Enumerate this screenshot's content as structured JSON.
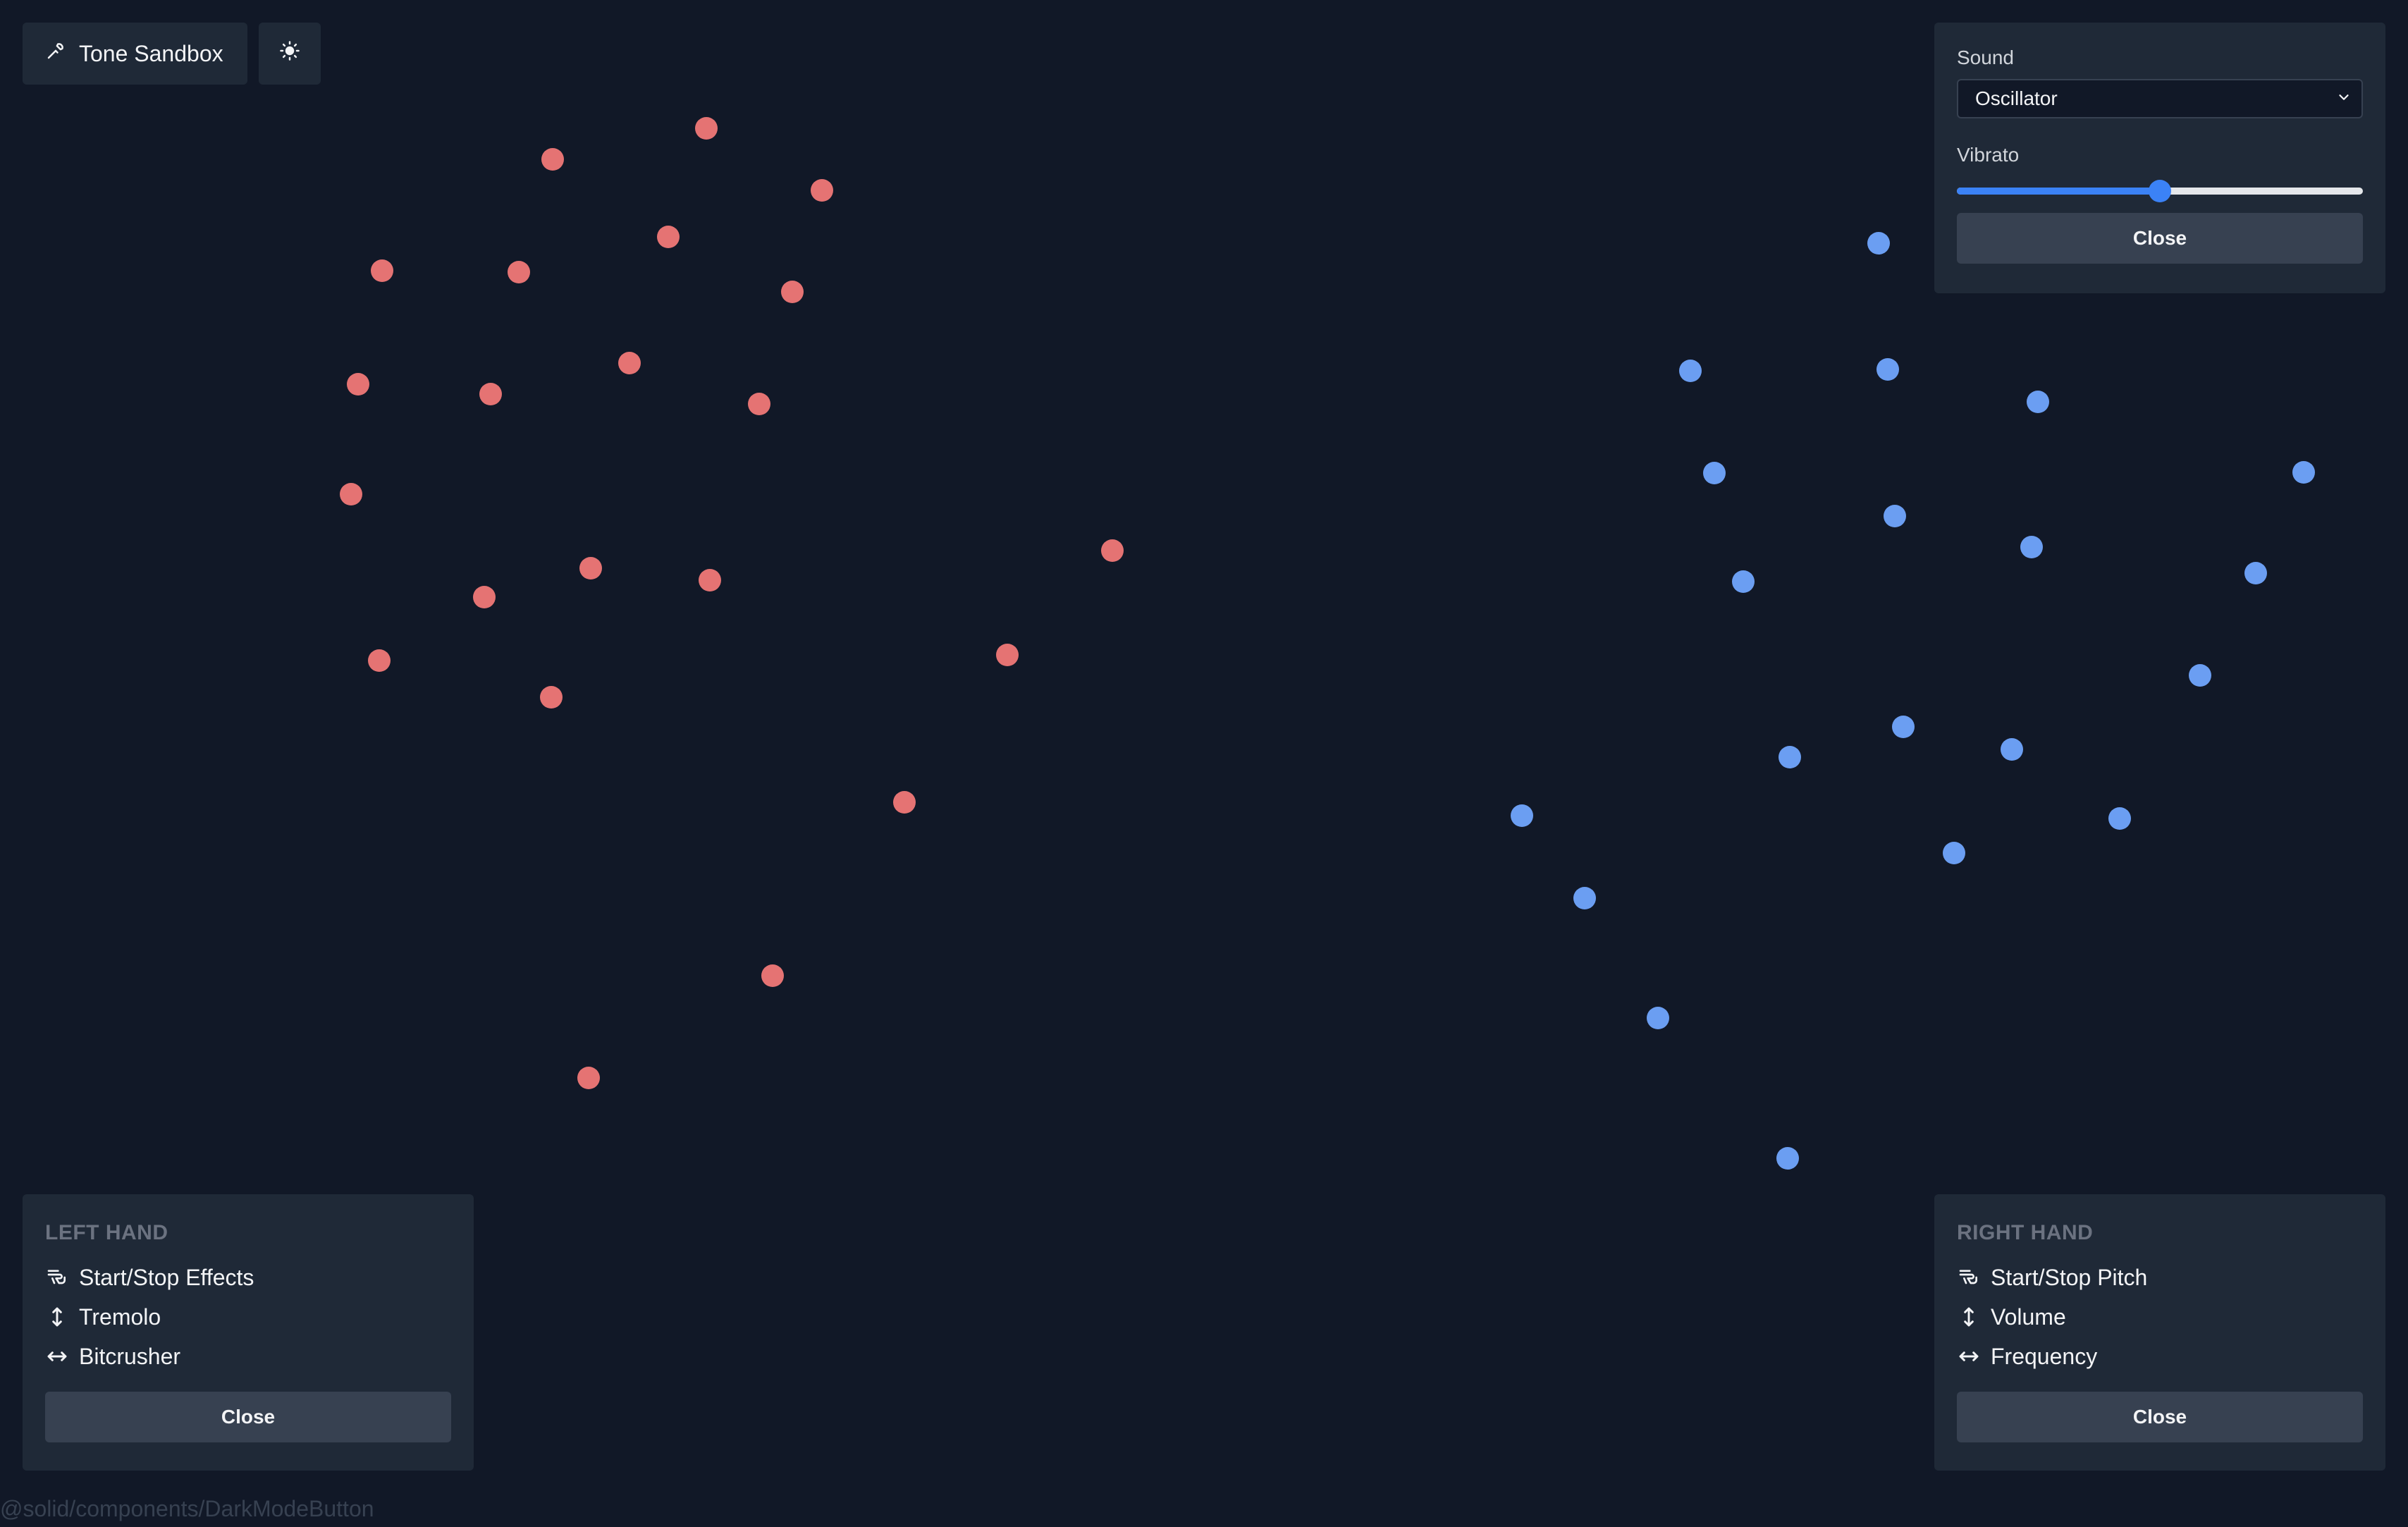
{
  "header": {
    "brand_label": "Tone Sandbox",
    "brand_icon": "wrench-icon",
    "theme_icon": "sun-icon"
  },
  "sound_panel": {
    "sound_label": "Sound",
    "sound_selected": "Oscillator",
    "vibrato_label": "Vibrato",
    "vibrato_level_percent": 50,
    "close_label": "Close"
  },
  "left_hand": {
    "title": "LEFT HAND",
    "items": [
      {
        "icon": "pinch-hand-icon",
        "label": "Start/Stop Effects"
      },
      {
        "icon": "vertical-arrows-icon",
        "label": "Tremolo"
      },
      {
        "icon": "horizontal-arrows-icon",
        "label": "Bitcrusher"
      }
    ],
    "close_label": "Close"
  },
  "right_hand": {
    "title": "RIGHT HAND",
    "items": [
      {
        "icon": "pinch-hand-icon",
        "label": "Start/Stop Pitch"
      },
      {
        "icon": "vertical-arrows-icon",
        "label": "Volume"
      },
      {
        "icon": "horizontal-arrows-icon",
        "label": "Frequency"
      }
    ],
    "close_label": "Close"
  },
  "footer": {
    "component_label": "@solid/components/DarkModeButton"
  },
  "colors": {
    "background": "#111827",
    "panel": "#1f2937",
    "left_hand_points": "#e57373",
    "right_hand_points": "#6b9ef2",
    "accent": "#3b82f6"
  }
}
